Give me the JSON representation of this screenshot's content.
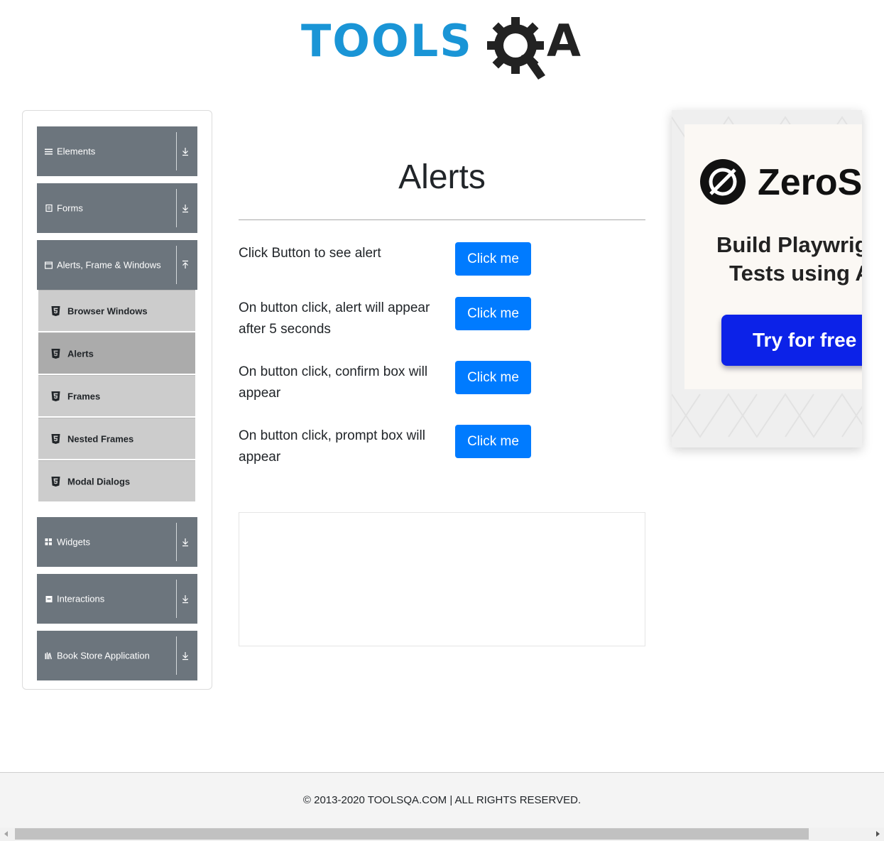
{
  "header": {
    "logo_left": "TOOLS",
    "logo_right": "A",
    "logo_icon": "gear-q-icon"
  },
  "sidebar": {
    "groups": [
      {
        "label": "Elements",
        "icon": "hamburger-icon",
        "expanded": false
      },
      {
        "label": "Forms",
        "icon": "form-icon",
        "expanded": false
      },
      {
        "label": "Alerts, Frame & Windows",
        "icon": "window-icon",
        "expanded": true
      },
      {
        "label": "Widgets",
        "icon": "grid-icon",
        "expanded": false
      },
      {
        "label": "Interactions",
        "icon": "square-icon",
        "expanded": false
      },
      {
        "label": "Book Store Application",
        "icon": "books-icon",
        "expanded": false
      }
    ],
    "sub_items": [
      {
        "label": "Browser Windows",
        "active": false
      },
      {
        "label": "Alerts",
        "active": true
      },
      {
        "label": "Frames",
        "active": false
      },
      {
        "label": "Nested Frames",
        "active": false
      },
      {
        "label": "Modal Dialogs",
        "active": false
      }
    ]
  },
  "main": {
    "title": "Alerts",
    "rows": [
      {
        "text": "Click Button to see alert",
        "button": "Click me"
      },
      {
        "text": "On button click, alert will appear after 5 seconds",
        "button": "Click me"
      },
      {
        "text": "On button click, confirm box will appear",
        "button": "Click me"
      },
      {
        "text": "On button click, prompt box will appear",
        "button": "Click me"
      }
    ]
  },
  "ad": {
    "brand": "ZeroSt",
    "headline_line1": "Build Playwrig",
    "headline_line2": "Tests using A",
    "cta": "Try for free →"
  },
  "footer": {
    "text": "© 2013-2020 TOOLSQA.COM | ALL RIGHTS RESERVED."
  },
  "colors": {
    "primary": "#007bff",
    "sidebar_header": "#6c757d",
    "sub_item": "#cccccc",
    "sub_item_active": "#ababab",
    "logo_blue": "#1a95d6",
    "ad_cta": "#0c22e8"
  }
}
